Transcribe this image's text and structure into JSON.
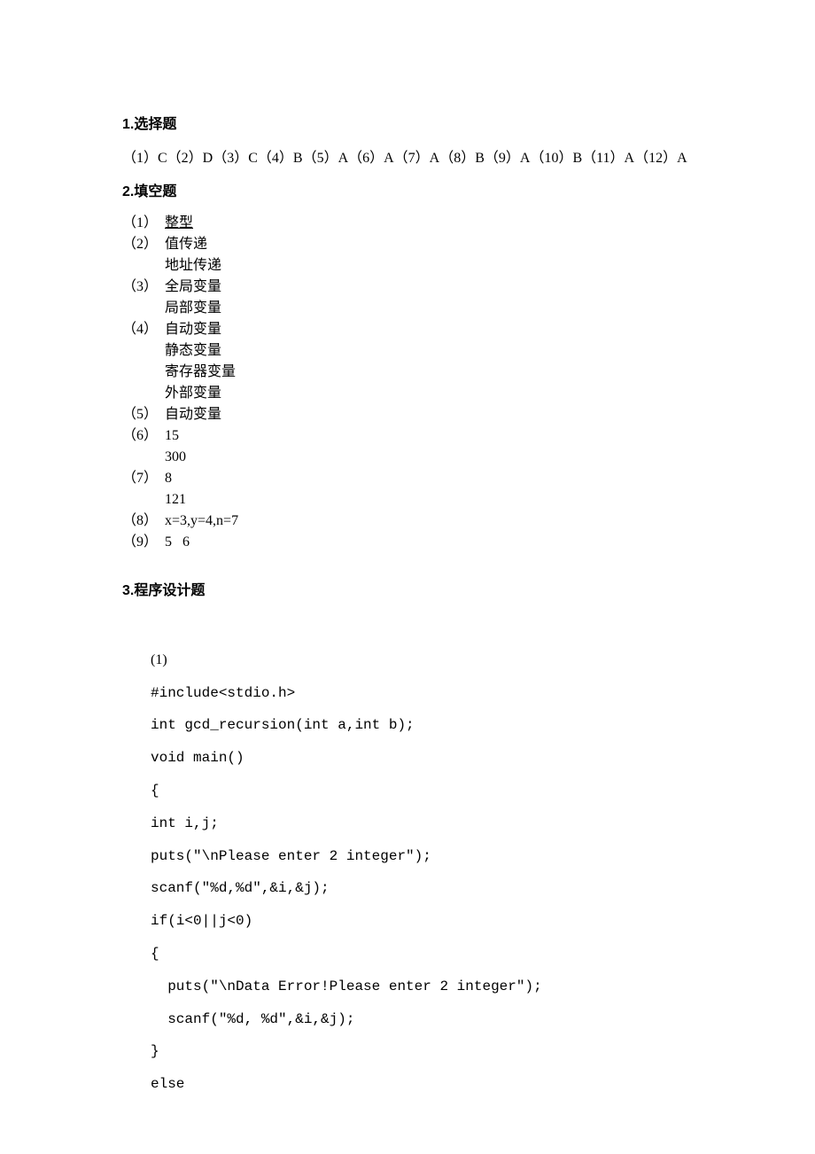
{
  "sections": {
    "s1": {
      "title": "1.选择题"
    },
    "s2": {
      "title": "2.填空题"
    },
    "s3": {
      "title": "3.程序设计题"
    }
  },
  "choice_answers": "（1）C（2）D（3）C（4）B（5）A（6）A（7）A（8）B（9）A（10）B（11）A（12）A",
  "fill": {
    "a1": {
      "n": "（1）",
      "v": "整型"
    },
    "a2": {
      "n": "（2）",
      "v": "值传递",
      "sub": [
        "地址传递"
      ]
    },
    "a3": {
      "n": "（3）",
      "v": "全局变量",
      "sub": [
        "局部变量"
      ]
    },
    "a4": {
      "n": "（4）",
      "v": "自动变量",
      "sub": [
        "静态变量",
        "寄存器变量",
        "外部变量"
      ]
    },
    "a5": {
      "n": "（5）",
      "v": "自动变量"
    },
    "a6": {
      "n": "（6）",
      "v": "15",
      "sub": [
        "300"
      ]
    },
    "a7": {
      "n": "（7）",
      "v": "8",
      "sub": [
        "121"
      ]
    },
    "a8": {
      "n": "（8）",
      "v": "x=3,y=4,n=7"
    },
    "a9": {
      "n": "（9）",
      "v": "5   6"
    }
  },
  "program": {
    "num": "(1)",
    "lines": {
      "l1": "#include<stdio.h>",
      "l2": "int gcd_recursion(int a,int b);",
      "l3": "void main()",
      "l4": "{",
      "l5": "int i,j;",
      "l6": "puts(\"\\nPlease enter 2 integer\");",
      "l7": "scanf(\"%d,%d\",&i,&j);",
      "l8": "if(i<0||j<0)",
      "l9": "{",
      "l10": "  puts(\"\\nData Error!Please enter 2 integer\");",
      "l11": "  scanf(\"%d, %d\",&i,&j);",
      "l12": "}",
      "l13": "else"
    }
  }
}
